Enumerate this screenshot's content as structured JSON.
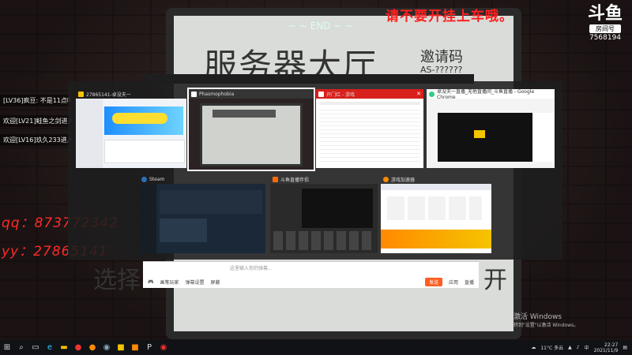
{
  "overlay": {
    "end_label": "~ ~ END ~ ~",
    "warning": "请不要开挂上车哦。",
    "logo_mark": "斗鱼",
    "logo_tag": "房间号",
    "room_number": "7568194",
    "contact_qq": "qq：873772342",
    "contact_yy": "yy：27865141"
  },
  "board": {
    "title": "服务器大厅",
    "invite_label": "邀请码",
    "invite_code": "AS-??????",
    "bottom_left": "选择",
    "bottom_right": "开"
  },
  "chat_messages": [
    "[LV36]疯豆: 不是11点吗",
    "欢迎[LV21]鲑鱼之剑进入",
    "欢迎[LV16]玖久233进入"
  ],
  "windows": [
    {
      "title": "27865141-卓没夫一",
      "icon_color": "#f5c400"
    },
    {
      "title": "Phasmophobia",
      "icon_color": "#ffffff"
    },
    {
      "title": "开门红 - 游戏",
      "icon_color": "#e33"
    },
    {
      "title": "卓没夫一直播_无他直播间_斗鱼直播 - Google Chrome",
      "icon_color": "#3c8"
    },
    {
      "title": "Steam",
      "icon_color": "#2a6fb8"
    },
    {
      "title": "斗鱼直播伴侣",
      "icon_color": "#ff6a00"
    },
    {
      "title": "游戏加速器",
      "icon_color": "#ff8a00"
    }
  ],
  "chat_panel": {
    "placeholder": "这里输入你的弹幕...",
    "actions": [
      "画笔玩家",
      "弹幕设置",
      "屏蔽"
    ],
    "send": "发送",
    "right_label": "应用",
    "extra": "直播"
  },
  "activation": {
    "line1": "激活 Windows",
    "line2": "转到\"设置\"以激活 Windows。"
  },
  "taskbar": {
    "weather": "11°C 多云",
    "ime": "中",
    "time": "22:27",
    "date": "2021/11/9"
  }
}
